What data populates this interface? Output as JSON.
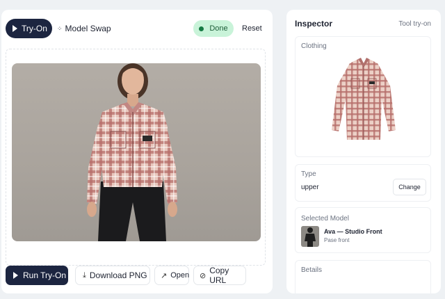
{
  "toolbar": {
    "tabs": [
      {
        "label": "Try-On",
        "icon": "play-icon",
        "active": true
      },
      {
        "label": "Model Swap",
        "icon": "swap-icon",
        "active": false
      }
    ],
    "status": {
      "label": "Done",
      "color": "#c9f3d9"
    },
    "reset_label": "Reset"
  },
  "actions": {
    "run_label": "Run Try-On",
    "download_label": "Download PNG",
    "open_label": "Open",
    "copy_label": "Copy URL"
  },
  "inspector": {
    "title": "Inspector",
    "subtitle": "Tool try-on",
    "clothing_label": "Clothing",
    "type": {
      "label": "Type",
      "value": "upper",
      "change_label": "Change"
    },
    "model": {
      "label": "Selected Model",
      "name": "Ava — Studio Front",
      "pose": "Pase front"
    },
    "details_label": "Betails"
  },
  "colors": {
    "accent": "#1c2540",
    "success": "#157a43",
    "shirt_plaid": "#c98a8a"
  }
}
